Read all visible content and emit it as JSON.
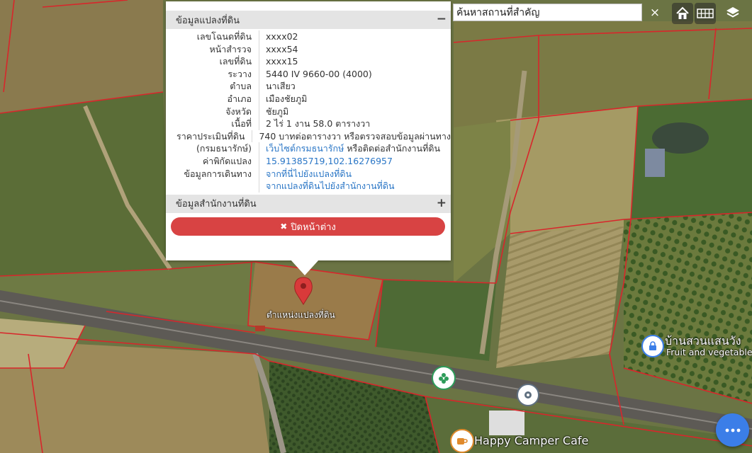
{
  "popup": {
    "section1_title": "ข้อมูลแปลงที่ดิน",
    "section1_toggle": "−",
    "rows": [
      {
        "label": "เลขโฉนดที่ดิน",
        "value": "xxxx02"
      },
      {
        "label": "หน้าสำรวจ",
        "value": "xxxx54"
      },
      {
        "label": "เลขที่ดิน",
        "value": "xxxx15"
      },
      {
        "label": "ระวาง",
        "value": "5440 IV 9660-00 (4000)"
      },
      {
        "label": "ตำบล",
        "value": "นาเสียว"
      },
      {
        "label": "อำเภอ",
        "value": "เมืองชัยภูมิ"
      },
      {
        "label": "จังหวัด",
        "value": "ชัยภูมิ"
      },
      {
        "label": "เนื้อที่",
        "value": "2 ไร่ 1 งาน 58.0 ตารางวา"
      }
    ],
    "price_label_1": "ราคาประเมินที่ดิน",
    "price_value_1": "740 บาทต่อตารางวา หรือตรวจสอบข้อมูลผ่านทาง",
    "price_label_2": "(กรมธนารักษ์)",
    "price_link": "เว็บไซต์กรมธนารักษ์",
    "price_value_2": " หรือติดต่อสำนักงานที่ดิน",
    "coord_label": "ค่าพิกัดแปลง",
    "coord_value": "15.91385719,102.16276957",
    "travel_label": "ข้อมูลการเดินทาง",
    "travel_link_1": "จากที่นี่ไปยังแปลงที่ดิน",
    "travel_link_2": "จากแปลงที่ดินไปยังสำนักงานที่ดิน",
    "section2_title": "ข้อมูลสำนักงานที่ดิน",
    "section2_toggle": "+",
    "close_label": "ปิดหน้าต่าง",
    "close_icon": "✖"
  },
  "search": {
    "placeholder": "ค้นหาสถานที่สำคัญ",
    "clear_icon": "×"
  },
  "controls": {
    "home_icon": "home-icon",
    "grid_icon": "grid-icon",
    "layers_icon": "layers-icon"
  },
  "map": {
    "parcel_label": "ตำแหน่งแปลงที่ดิน",
    "poi_1_line1": "บ้านสวนแสนวัง",
    "poi_1_line2": "Fruit and vegetable",
    "poi_2": "Happy Camper Cafe"
  },
  "colors": {
    "accent_red": "#d84343",
    "link_blue": "#2a76c6",
    "fab_blue": "#3b7ee8",
    "parcel_line": "#d8262b"
  }
}
